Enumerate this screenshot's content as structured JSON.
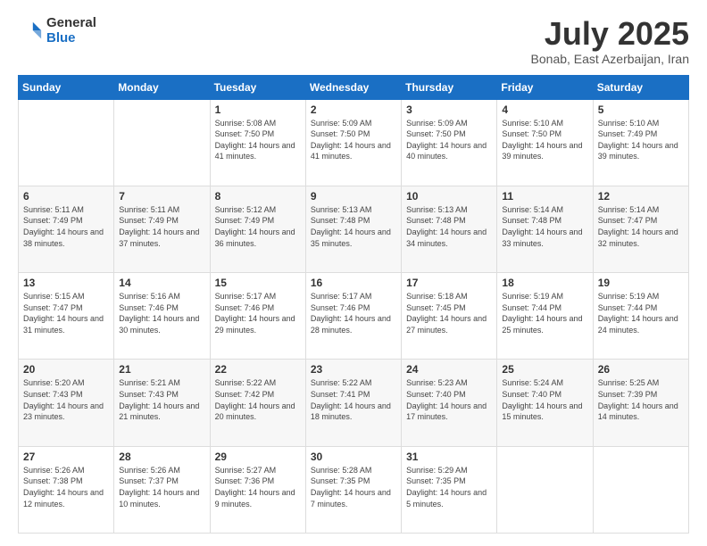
{
  "header": {
    "logo_general": "General",
    "logo_blue": "Blue",
    "title": "July 2025",
    "location": "Bonab, East Azerbaijan, Iran"
  },
  "days_header": [
    "Sunday",
    "Monday",
    "Tuesday",
    "Wednesday",
    "Thursday",
    "Friday",
    "Saturday"
  ],
  "weeks": [
    {
      "days": [
        {
          "num": "",
          "detail": ""
        },
        {
          "num": "",
          "detail": ""
        },
        {
          "num": "1",
          "detail": "Sunrise: 5:08 AM\nSunset: 7:50 PM\nDaylight: 14 hours and 41 minutes."
        },
        {
          "num": "2",
          "detail": "Sunrise: 5:09 AM\nSunset: 7:50 PM\nDaylight: 14 hours and 41 minutes."
        },
        {
          "num": "3",
          "detail": "Sunrise: 5:09 AM\nSunset: 7:50 PM\nDaylight: 14 hours and 40 minutes."
        },
        {
          "num": "4",
          "detail": "Sunrise: 5:10 AM\nSunset: 7:50 PM\nDaylight: 14 hours and 39 minutes."
        },
        {
          "num": "5",
          "detail": "Sunrise: 5:10 AM\nSunset: 7:49 PM\nDaylight: 14 hours and 39 minutes."
        }
      ]
    },
    {
      "days": [
        {
          "num": "6",
          "detail": "Sunrise: 5:11 AM\nSunset: 7:49 PM\nDaylight: 14 hours and 38 minutes."
        },
        {
          "num": "7",
          "detail": "Sunrise: 5:11 AM\nSunset: 7:49 PM\nDaylight: 14 hours and 37 minutes."
        },
        {
          "num": "8",
          "detail": "Sunrise: 5:12 AM\nSunset: 7:49 PM\nDaylight: 14 hours and 36 minutes."
        },
        {
          "num": "9",
          "detail": "Sunrise: 5:13 AM\nSunset: 7:48 PM\nDaylight: 14 hours and 35 minutes."
        },
        {
          "num": "10",
          "detail": "Sunrise: 5:13 AM\nSunset: 7:48 PM\nDaylight: 14 hours and 34 minutes."
        },
        {
          "num": "11",
          "detail": "Sunrise: 5:14 AM\nSunset: 7:48 PM\nDaylight: 14 hours and 33 minutes."
        },
        {
          "num": "12",
          "detail": "Sunrise: 5:14 AM\nSunset: 7:47 PM\nDaylight: 14 hours and 32 minutes."
        }
      ]
    },
    {
      "days": [
        {
          "num": "13",
          "detail": "Sunrise: 5:15 AM\nSunset: 7:47 PM\nDaylight: 14 hours and 31 minutes."
        },
        {
          "num": "14",
          "detail": "Sunrise: 5:16 AM\nSunset: 7:46 PM\nDaylight: 14 hours and 30 minutes."
        },
        {
          "num": "15",
          "detail": "Sunrise: 5:17 AM\nSunset: 7:46 PM\nDaylight: 14 hours and 29 minutes."
        },
        {
          "num": "16",
          "detail": "Sunrise: 5:17 AM\nSunset: 7:46 PM\nDaylight: 14 hours and 28 minutes."
        },
        {
          "num": "17",
          "detail": "Sunrise: 5:18 AM\nSunset: 7:45 PM\nDaylight: 14 hours and 27 minutes."
        },
        {
          "num": "18",
          "detail": "Sunrise: 5:19 AM\nSunset: 7:44 PM\nDaylight: 14 hours and 25 minutes."
        },
        {
          "num": "19",
          "detail": "Sunrise: 5:19 AM\nSunset: 7:44 PM\nDaylight: 14 hours and 24 minutes."
        }
      ]
    },
    {
      "days": [
        {
          "num": "20",
          "detail": "Sunrise: 5:20 AM\nSunset: 7:43 PM\nDaylight: 14 hours and 23 minutes."
        },
        {
          "num": "21",
          "detail": "Sunrise: 5:21 AM\nSunset: 7:43 PM\nDaylight: 14 hours and 21 minutes."
        },
        {
          "num": "22",
          "detail": "Sunrise: 5:22 AM\nSunset: 7:42 PM\nDaylight: 14 hours and 20 minutes."
        },
        {
          "num": "23",
          "detail": "Sunrise: 5:22 AM\nSunset: 7:41 PM\nDaylight: 14 hours and 18 minutes."
        },
        {
          "num": "24",
          "detail": "Sunrise: 5:23 AM\nSunset: 7:40 PM\nDaylight: 14 hours and 17 minutes."
        },
        {
          "num": "25",
          "detail": "Sunrise: 5:24 AM\nSunset: 7:40 PM\nDaylight: 14 hours and 15 minutes."
        },
        {
          "num": "26",
          "detail": "Sunrise: 5:25 AM\nSunset: 7:39 PM\nDaylight: 14 hours and 14 minutes."
        }
      ]
    },
    {
      "days": [
        {
          "num": "27",
          "detail": "Sunrise: 5:26 AM\nSunset: 7:38 PM\nDaylight: 14 hours and 12 minutes."
        },
        {
          "num": "28",
          "detail": "Sunrise: 5:26 AM\nSunset: 7:37 PM\nDaylight: 14 hours and 10 minutes."
        },
        {
          "num": "29",
          "detail": "Sunrise: 5:27 AM\nSunset: 7:36 PM\nDaylight: 14 hours and 9 minutes."
        },
        {
          "num": "30",
          "detail": "Sunrise: 5:28 AM\nSunset: 7:35 PM\nDaylight: 14 hours and 7 minutes."
        },
        {
          "num": "31",
          "detail": "Sunrise: 5:29 AM\nSunset: 7:35 PM\nDaylight: 14 hours and 5 minutes."
        },
        {
          "num": "",
          "detail": ""
        },
        {
          "num": "",
          "detail": ""
        }
      ]
    }
  ]
}
